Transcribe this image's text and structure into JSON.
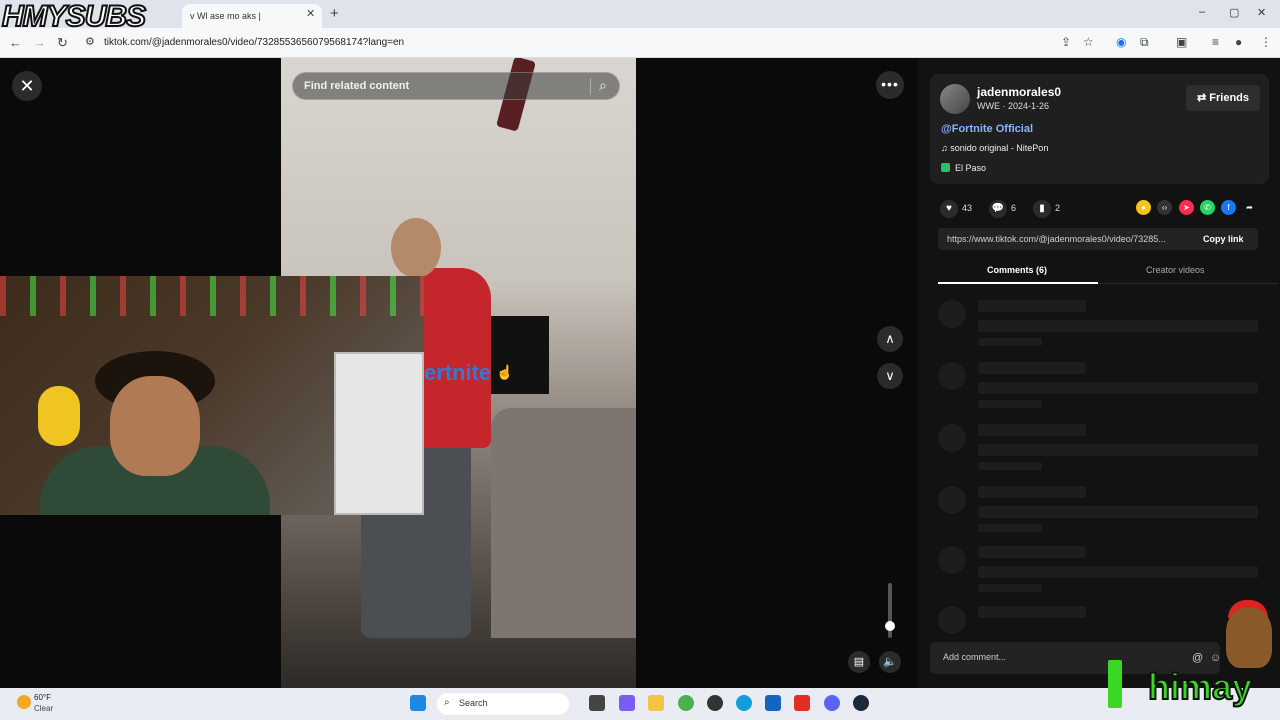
{
  "watermark": "HMYSUBS",
  "browser": {
    "tab_title": "v Wl    ase  mo  aks  |",
    "url": "tiktok.com/@jadenmorales0/video/7328553656079568174?lang=en",
    "window_controls": [
      "–",
      "▢",
      "✕"
    ]
  },
  "viewer": {
    "search_placeholder": "Find related content",
    "overlay_text": "ertnite"
  },
  "author": {
    "username": "jadenmorales0",
    "subtitle": "WWE · 2024-1-26",
    "friends_label": "Friends",
    "mention": "@Fortnite Official",
    "music": "sonido original - NitePon",
    "location": "El Paso"
  },
  "stats": {
    "likes": "43",
    "comments": "6",
    "saves": "2"
  },
  "share": {
    "link": "https://www.tiktok.com/@jadenmorales0/video/73285...",
    "copy_label": "Copy link"
  },
  "tabs": {
    "comments": "Comments (6)",
    "creator": "Creator videos"
  },
  "comment_input": {
    "placeholder": "Add comment..."
  },
  "taskbar": {
    "temp": "60°F",
    "condition": "Clear",
    "search": "Search"
  },
  "overlay_brand": "himay",
  "colors": {
    "accent_blue": "#2f7ad8",
    "link_blue": "#8ab4ff",
    "brand_green": "#3ad824"
  }
}
